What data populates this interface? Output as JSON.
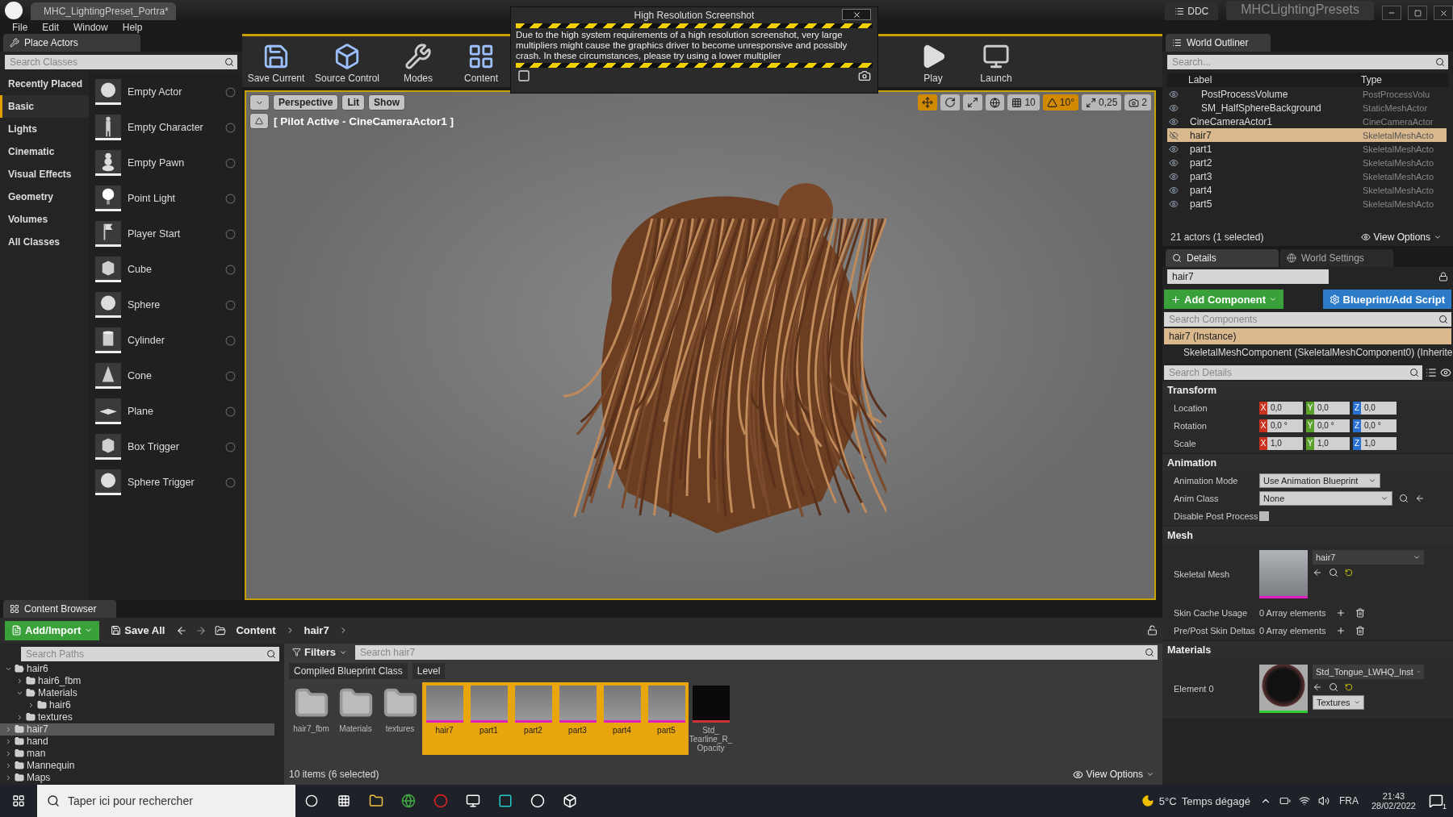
{
  "title_bar": {
    "tab": "MHC_LightingPreset_Portra*",
    "ddc": "DDC",
    "project": "MHCLightingPresets"
  },
  "menu": [
    "File",
    "Edit",
    "Window",
    "Help"
  ],
  "place_actors": {
    "title": "Place Actors",
    "search": {
      "placeholder": "Search Classes"
    },
    "categories": [
      {
        "label": "Recently Placed",
        "selected": false
      },
      {
        "label": "Basic",
        "selected": true
      },
      {
        "label": "Lights",
        "selected": false
      },
      {
        "label": "Cinematic",
        "selected": false
      },
      {
        "label": "Visual Effects",
        "selected": false
      },
      {
        "label": "Geometry",
        "selected": false
      },
      {
        "label": "Volumes",
        "selected": false
      },
      {
        "label": "All Classes",
        "selected": false
      }
    ],
    "items": [
      {
        "label": "Empty Actor",
        "kind": "sphere"
      },
      {
        "label": "Empty Character",
        "kind": "figure"
      },
      {
        "label": "Empty Pawn",
        "kind": "pawn"
      },
      {
        "label": "Point Light",
        "kind": "bulb"
      },
      {
        "label": "Player Start",
        "kind": "flag"
      },
      {
        "label": "Cube",
        "kind": "cube"
      },
      {
        "label": "Sphere",
        "kind": "sphere"
      },
      {
        "label": "Cylinder",
        "kind": "cylinder"
      },
      {
        "label": "Cone",
        "kind": "cone"
      },
      {
        "label": "Plane",
        "kind": "plane"
      },
      {
        "label": "Box Trigger",
        "kind": "cube"
      },
      {
        "label": "Sphere Trigger",
        "kind": "sphere"
      }
    ]
  },
  "toolbar": [
    {
      "label": "Save Current",
      "kind": "save"
    },
    {
      "label": "Source Control",
      "kind": "source"
    },
    {
      "label": "Modes",
      "kind": "modes"
    },
    {
      "label": "Content",
      "kind": "content"
    },
    {
      "label": "Play",
      "kind": "play"
    },
    {
      "label": "Launch",
      "kind": "launch"
    }
  ],
  "dialog": {
    "title": "High Resolution Screenshot",
    "message": "Due to the high system requirements of a high resolution screenshot, very large multipliers might cause the graphics driver to become unresponsive and possibly crash. In these circumstances, please try using a lower multiplier"
  },
  "viewport": {
    "view_buttons": [
      "Perspective",
      "Lit",
      "Show"
    ],
    "pilot_label": "[ Pilot Active - CineCameraActor1 ]",
    "tools": [
      {
        "kind": "move",
        "selected": true
      },
      {
        "kind": "rotate",
        "selected": false
      },
      {
        "kind": "scale",
        "selected": false
      }
    ],
    "snaps": [
      {
        "kind": "grid",
        "value": "10",
        "on": false
      },
      {
        "kind": "angle",
        "value": "10°",
        "on": true
      },
      {
        "kind": "scale",
        "value": "0,25",
        "on": false
      },
      {
        "kind": "camera",
        "value": "2",
        "on": false
      }
    ]
  },
  "outliner": {
    "title": "World Outliner",
    "search": {
      "placeholder": "Search..."
    },
    "columns": [
      "Label",
      "Type"
    ],
    "rows": [
      {
        "children": [
          {
            "label": "PostProcessVolume",
            "type": "PostProcessVolu",
            "visible": true,
            "selected": false
          },
          {
            "label": "SM_HalfSphereBackground",
            "type": "StaticMeshActor",
            "visible": true,
            "selected": false
          }
        ]
      },
      {
        "label": "CineCameraActor1",
        "type": "CineCameraActor",
        "visible": true,
        "selected": false
      },
      {
        "label": "hair7",
        "type": "SkeletalMeshActo",
        "visible": false,
        "selected": true
      },
      {
        "label": "part1",
        "type": "SkeletalMeshActo",
        "visible": true,
        "selected": false
      },
      {
        "label": "part2",
        "type": "SkeletalMeshActo",
        "visible": true,
        "selected": false
      },
      {
        "label": "part3",
        "type": "SkeletalMeshActo",
        "visible": true,
        "selected": false
      },
      {
        "label": "part4",
        "type": "SkeletalMeshActo",
        "visible": true,
        "selected": false
      },
      {
        "label": "part5",
        "type": "SkeletalMeshActo",
        "visible": true,
        "selected": false
      }
    ],
    "status": "21 actors (1 selected)",
    "view_options": "View Options"
  },
  "details": {
    "tabs": [
      {
        "label": "Details",
        "selected": true
      },
      {
        "label": "World Settings",
        "selected": false
      }
    ],
    "name": "hair7",
    "add_component": "Add Component",
    "blueprint": "Blueprint/Add Script",
    "search_components": {
      "placeholder": "Search Components"
    },
    "components": [
      {
        "label": "hair7 (Instance)",
        "selected": true,
        "children": [
          {
            "label": "SkeletalMeshComponent (SkeletalMeshComponent0) (Inherite",
            "selected": false
          }
        ]
      }
    ],
    "search_details": {
      "placeholder": "Search Details"
    },
    "sections": [
      {
        "title": "Transform",
        "rows": [
          {
            "kind": "vector",
            "label": "Location",
            "values": [
              {
                "axis": "X",
                "value": "0,0"
              },
              {
                "axis": "Y",
                "value": "0,0"
              },
              {
                "axis": "Z",
                "value": "0,0"
              }
            ]
          },
          {
            "kind": "vector",
            "label": "Rotation",
            "values": [
              {
                "axis": "X",
                "value": "0,0 °"
              },
              {
                "axis": "Y",
                "value": "0,0 °"
              },
              {
                "axis": "Z",
                "value": "0,0 °"
              }
            ]
          },
          {
            "kind": "vector",
            "label": "Scale",
            "values": [
              {
                "axis": "X",
                "value": "1,0"
              },
              {
                "axis": "Y",
                "value": "1,0"
              },
              {
                "axis": "Z",
                "value": "1,0"
              }
            ]
          }
        ]
      },
      {
        "title": "Animation",
        "rows": [
          {
            "kind": "dropdown",
            "label": "Animation Mode",
            "value": "Use Animation Blueprint"
          },
          {
            "kind": "combo",
            "label": "Anim Class",
            "value": "None"
          },
          {
            "kind": "checkbox",
            "label": "Disable Post Process",
            "checked": false
          }
        ]
      },
      {
        "title": "Mesh",
        "rows": [
          {
            "kind": "asset",
            "label": "Skeletal Mesh",
            "value": "hair7"
          },
          {
            "kind": "array",
            "label": "Skin Cache Usage",
            "value": "0 Array elements"
          },
          {
            "kind": "array",
            "label": "Pre/Post Skin Deltas",
            "value": "0 Array elements"
          }
        ]
      },
      {
        "title": "Materials",
        "rows": [
          {
            "kind": "material",
            "label": "Element 0",
            "value": "Std_Tongue_LWHQ_Inst",
            "button": "Textures"
          }
        ]
      }
    ]
  },
  "content_browser": {
    "title": "Content Browser",
    "add": "Add/Import",
    "save": "Save All",
    "path": [
      "Content",
      "hair7"
    ],
    "search_paths": {
      "placeholder": "Search Paths"
    },
    "tree": [
      {
        "label": "hair6",
        "selected": false,
        "expanded": true,
        "children": [
          {
            "label": "hair6_fbm",
            "selected": false,
            "expanded": false
          },
          {
            "label": "Materials",
            "selected": false,
            "expanded": true,
            "children": [
              {
                "label": "hair6",
                "selected": false,
                "expanded": false
              }
            ]
          },
          {
            "label": "textures",
            "selected": false,
            "expanded": false
          }
        ]
      },
      {
        "label": "hair7",
        "selected": true,
        "expanded": false
      },
      {
        "label": "hand",
        "selected": false,
        "expanded": false
      },
      {
        "label": "man",
        "selected": false,
        "expanded": false
      },
      {
        "label": "Mannequin",
        "selected": false,
        "expanded": false
      },
      {
        "label": "Maps",
        "selected": false,
        "expanded": false
      }
    ],
    "filters": "Filters",
    "search": {
      "placeholder": "Search hair7"
    },
    "chips": [
      "Compiled Blueprint Class",
      "Level"
    ],
    "assets": [
      {
        "label": "hair7_fbm",
        "kind": "folder",
        "selected": false
      },
      {
        "label": "Materials",
        "kind": "folder",
        "selected": false
      },
      {
        "label": "textures",
        "kind": "folder",
        "selected": false
      },
      {
        "label": "hair7",
        "kind": "mesh",
        "selected": true
      },
      {
        "label": "part1",
        "kind": "mesh",
        "selected": true
      },
      {
        "label": "part2",
        "kind": "mesh",
        "selected": true
      },
      {
        "label": "part3",
        "kind": "mesh",
        "selected": true
      },
      {
        "label": "part4",
        "kind": "mesh",
        "selected": true
      },
      {
        "label": "part5",
        "kind": "mesh",
        "selected": true
      },
      {
        "label": "Std_ Tearline_R_ Opacity",
        "kind": "texture",
        "selected": false
      }
    ],
    "status": "10 items (6 selected)",
    "view_options": "View Options"
  },
  "taskbar": {
    "search": {
      "placeholder": "Taper ici pour rechercher"
    },
    "temperature": "5°C",
    "weather": "Temps dégagé",
    "language": "FRA",
    "time": "21:43",
    "date": "28/02/2022",
    "notifications": "1"
  }
}
